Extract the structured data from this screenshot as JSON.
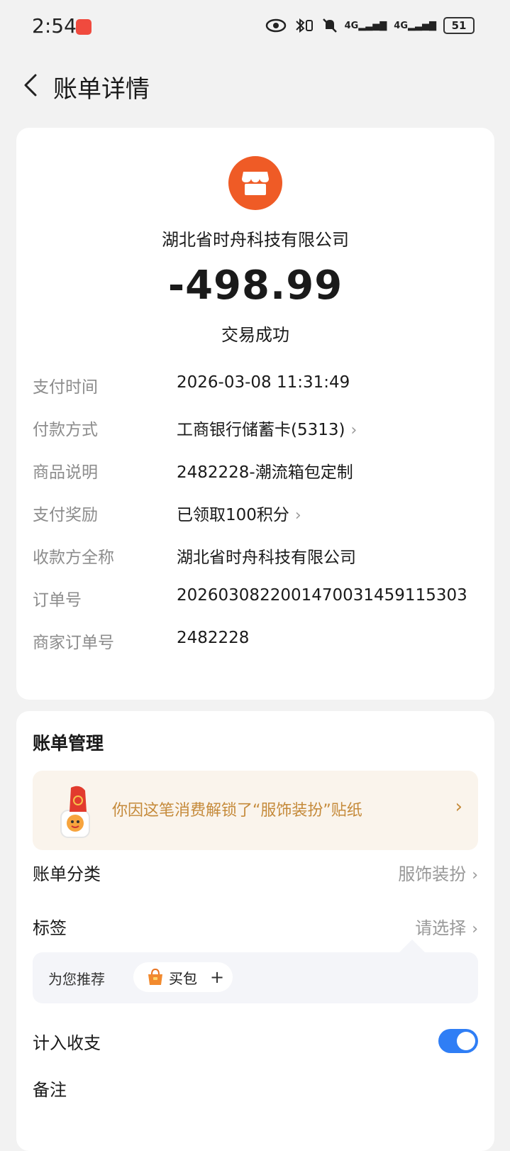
{
  "status_bar": {
    "time": "2:54",
    "battery": "51",
    "network1": "4G",
    "network2": "4G"
  },
  "header": {
    "title": "账单详情"
  },
  "summary": {
    "merchant": "湖北省时舟科技有限公司",
    "amount": "-498.99",
    "status": "交易成功"
  },
  "details": [
    {
      "label": "支付时间",
      "value": "2026-03-08 11:31:49"
    },
    {
      "label": "付款方式",
      "value": "工商银行储蓄卡(5313)"
    },
    {
      "label": "商品说明",
      "value": "2482228-潮流箱包定制"
    },
    {
      "label": "支付奖励",
      "value": "已领取100积分"
    },
    {
      "label": "收款方全称",
      "value": "湖北省时舟科技有限公司"
    },
    {
      "label": "订单号",
      "value": "2026030822001470031459115303"
    },
    {
      "label": "商家订单号",
      "value": "2482228"
    }
  ],
  "management": {
    "title": "账单管理",
    "sticker_text": "你因这笔消费解锁了“服饰装扮”贴纸",
    "category_label": "账单分类",
    "category_value": "服饰装扮",
    "tag_label": "标签",
    "tag_value": "请选择",
    "suggest_label": "为您推荐",
    "suggest_tag": "买包",
    "suggest_plus": "+",
    "income_label": "计入收支",
    "income_on": true,
    "note_label": "备注"
  }
}
